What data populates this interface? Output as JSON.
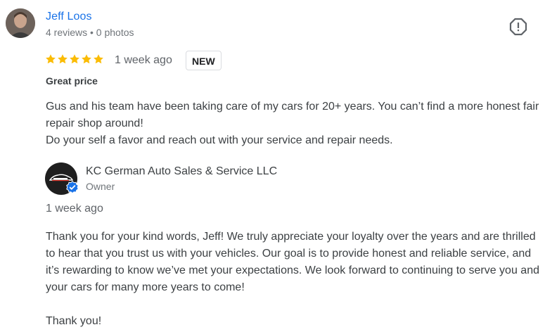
{
  "review": {
    "reviewer_name": "Jeff Loos",
    "reviewer_meta": "4 reviews • 0 photos",
    "rating": 5,
    "rating_max": 5,
    "date": "1 week ago",
    "badge": "NEW",
    "subtitle": "Great price",
    "text_line1": "Gus and his team have been taking care of my cars for 20+ years. You can’t find a more honest fair repair shop around!",
    "text_line2": "Do your self a favor and reach out with your service and repair needs."
  },
  "reply": {
    "owner_name": "KC German Auto Sales & Service LLC",
    "owner_role": "Owner",
    "date": "1 week ago",
    "text": "Thank you for your kind words, Jeff! We truly appreciate your loyalty over the years and are thrilled to hear that you trust us with your vehicles. Our goal is to provide honest and reliable service, and it’s rewarding to know we’ve met your expectations. We look forward to continuing to serve you and your cars for many more years to come!",
    "closing": "Thank you!"
  },
  "icons": {
    "report": "report-flag-icon",
    "star": "star-icon",
    "verified": "verified-check-icon"
  },
  "colors": {
    "link": "#1a73e8",
    "star": "#fbbc04",
    "verified": "#1a73e8"
  }
}
